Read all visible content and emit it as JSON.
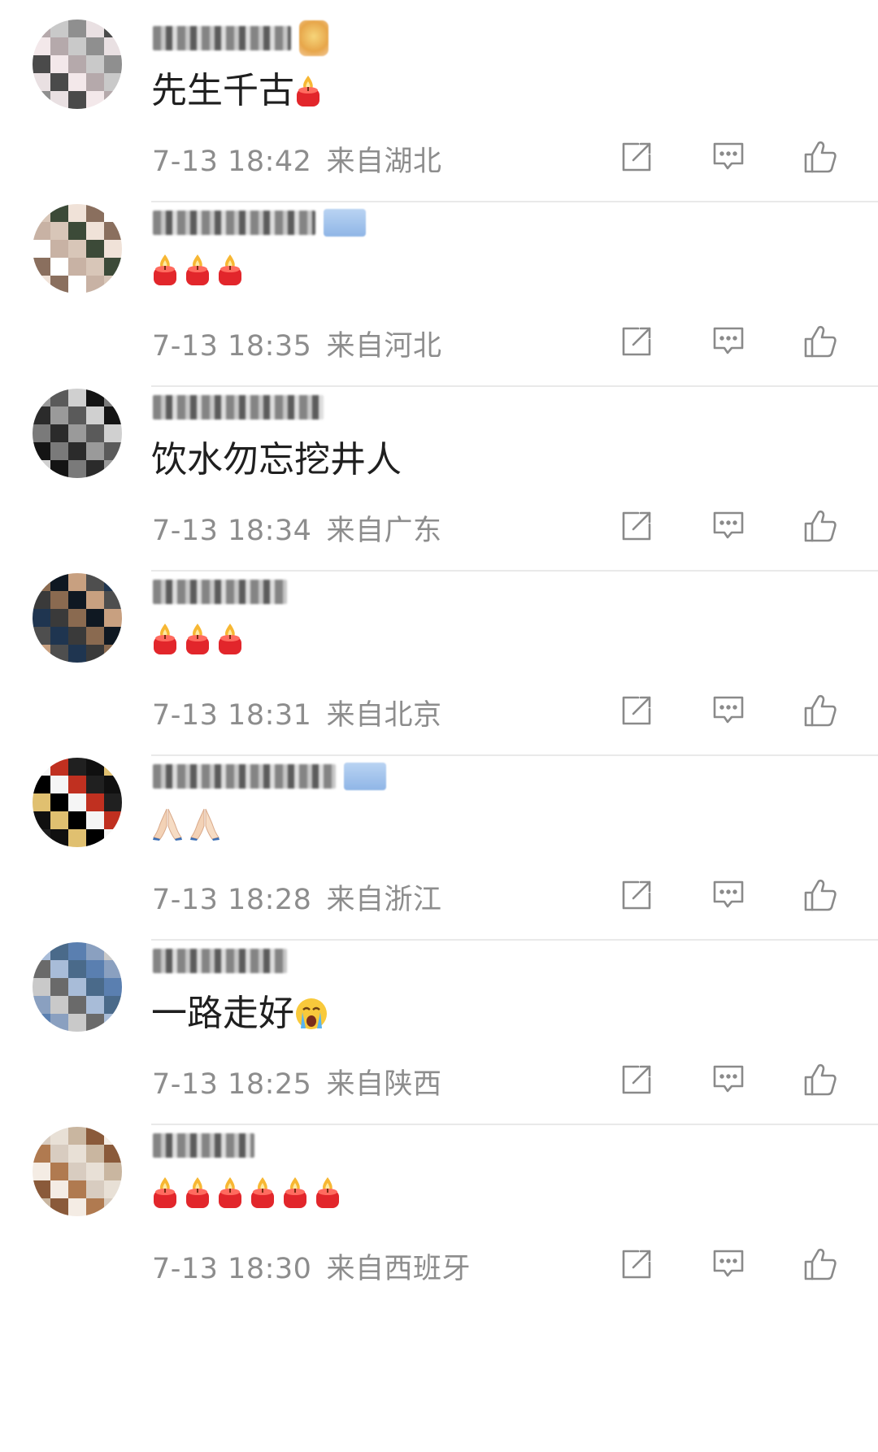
{
  "comments": [
    {
      "text": "先生千古",
      "emoji": "candle",
      "emoji_count": 1,
      "emoji_after_text": true,
      "time": "7-13 18:42",
      "location": "来自湖北",
      "badge": "gold"
    },
    {
      "text": "",
      "emoji": "candle",
      "emoji_count": 3,
      "emoji_after_text": false,
      "time": "7-13 18:35",
      "location": "来自河北",
      "badge": "blue"
    },
    {
      "text": "饮水勿忘挖井人",
      "emoji": "none",
      "emoji_count": 0,
      "emoji_after_text": false,
      "time": "7-13 18:34",
      "location": "来自广东",
      "badge": "none"
    },
    {
      "text": "",
      "emoji": "candle",
      "emoji_count": 3,
      "emoji_after_text": false,
      "time": "7-13 18:31",
      "location": "来自北京",
      "badge": "none"
    },
    {
      "text": "",
      "emoji": "pray",
      "emoji_count": 2,
      "emoji_after_text": false,
      "time": "7-13 18:28",
      "location": "来自浙江",
      "badge": "blue"
    },
    {
      "text": "一路走好",
      "emoji": "crying",
      "emoji_count": 1,
      "emoji_after_text": true,
      "time": "7-13 18:25",
      "location": "来自陕西",
      "badge": "none"
    },
    {
      "text": "",
      "emoji": "candle",
      "emoji_count": 6,
      "emoji_after_text": false,
      "time": "7-13 18:30",
      "location": "来自西班牙",
      "badge": "none"
    }
  ],
  "icons": {
    "share": "share-icon",
    "reply": "comment-icon",
    "like": "thumbs-up-icon"
  },
  "colors": {
    "text": "#1f1f1f",
    "meta": "#8d8d8d",
    "icon": "#8a8a8a",
    "divider": "#e9e9e9",
    "candle": "#e2262b",
    "flame": "#f5a623"
  }
}
